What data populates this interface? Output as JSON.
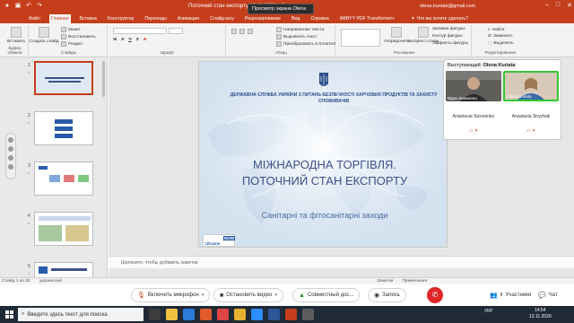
{
  "powerpoint": {
    "filename": "Поточний стан експорту 16.11.2020 · Сохранено",
    "account": "olena.kuriata@gmail.com",
    "tabs": [
      "Файл",
      "Главная",
      "Вставка",
      "Конструктор",
      "Переходы",
      "Анимация",
      "Слайд-шоу",
      "Рецензирование",
      "Вид",
      "Справка",
      "ABBYY PDF Transformer+"
    ],
    "active_tab": "Главная",
    "search_tab": "Что вы хотите сделать?",
    "ribbon": {
      "clipboard_label": "Буфер обмена",
      "paste": "Вставить",
      "slides_label": "Слайды",
      "new_slide": "Создать слайд",
      "layout": "Макет",
      "reset": "Восстановить",
      "section": "Раздел",
      "font_label": "Шрифт",
      "paragraph_label": "Абзац",
      "text_direction": "Направление текста",
      "align_text": "Выровнять текст",
      "smartart": "Преобразовать в SmartArt",
      "drawing_label": "Рисование",
      "arrange": "Упорядочить",
      "quick_styles": "Экспресс-стили",
      "shape_fill": "Заливка фигуры",
      "shape_outline": "Контур фигуры",
      "shape_effects": "Эффекты фигуры",
      "editing_label": "Редактирование",
      "find": "Найти",
      "replace": "Заменить",
      "select": "Выделить"
    },
    "thumbnails": [
      {
        "num": "1",
        "star": "*"
      },
      {
        "num": "2",
        "star": "*"
      },
      {
        "num": "3",
        "star": "*"
      },
      {
        "num": "4",
        "star": "*"
      },
      {
        "num": "5",
        "star": "*"
      }
    ],
    "slide": {
      "agency": "ДЕРЖАВНА СЛУЖБА УКРАЇНИ З ПИТАНЬ БЕЗПЕЧНОСТІ ХАРЧОВИХ ПРОДУКТІВ ТА ЗАХИСТУ СПОЖИВАЧІВ",
      "title_line1": "МІЖНАРОДНА ТОРГІВЛЯ.",
      "title_line2": "ПОТОЧНИЙ СТАН ЕКСПОРТУ",
      "subtitle": "Санітарні та фітосанітарні заходи",
      "logo_now": "NOW",
      "logo_ua": "Ukraine"
    },
    "notes_placeholder": "Щелкните, чтобы добавить заметки",
    "status": {
      "slide_of": "Слайд 1 из 33",
      "language": "украинский",
      "notes": "Заметки",
      "comments": "Примечания"
    }
  },
  "zoom": {
    "share_banner": "Просмотр экрана Olena Kuri...",
    "speaker_label": "Выступающий:",
    "speaker_name": "Olena Kuriata",
    "participants": [
      {
        "name": "Anastasia Sizonenko",
        "video_label": "Відео вимкнено"
      },
      {
        "name": "Anastasia Stryzhak",
        "video_label": "Olena Kuriata"
      }
    ],
    "controls": {
      "mic": "Включить микрофон",
      "video": "Остановить видео",
      "share": "Совместный дос...",
      "record": "Запись",
      "participants": "Участники",
      "participants_count": "8",
      "chat": "Чат"
    }
  },
  "taskbar": {
    "search_placeholder": "Введите здесь текст для поиска",
    "lang": "УКР",
    "time": "14:54",
    "date": "13.11.2020"
  },
  "colors": {
    "ppt_accent": "#c43e1c",
    "slide_title": "#3c4f8a",
    "zoom_end": "#e02828",
    "taskbar": "#1f2a36"
  }
}
